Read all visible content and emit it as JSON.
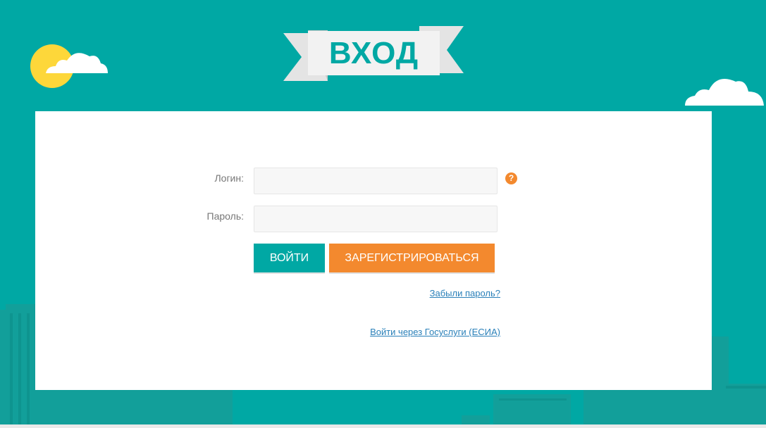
{
  "header": {
    "title": "ВХОД"
  },
  "form": {
    "login_label": "Логин:",
    "login_value": "",
    "password_label": "Пароль:",
    "password_value": "",
    "help_icon": "?",
    "login_button": "ВОЙТИ",
    "register_button": "ЗАРЕГИСТРИРОВАТЬСЯ",
    "forgot_password_link": "Забыли пароль?",
    "gosuslugi_link": "Войти через Госуслуги (ЕСИА)"
  },
  "colors": {
    "background": "#00a8a4",
    "accent_orange": "#f3892e",
    "sun": "#fdd73a",
    "link": "#2a80b9"
  },
  "icons": [
    "sun-icon",
    "cloud-icon",
    "help-icon"
  ]
}
